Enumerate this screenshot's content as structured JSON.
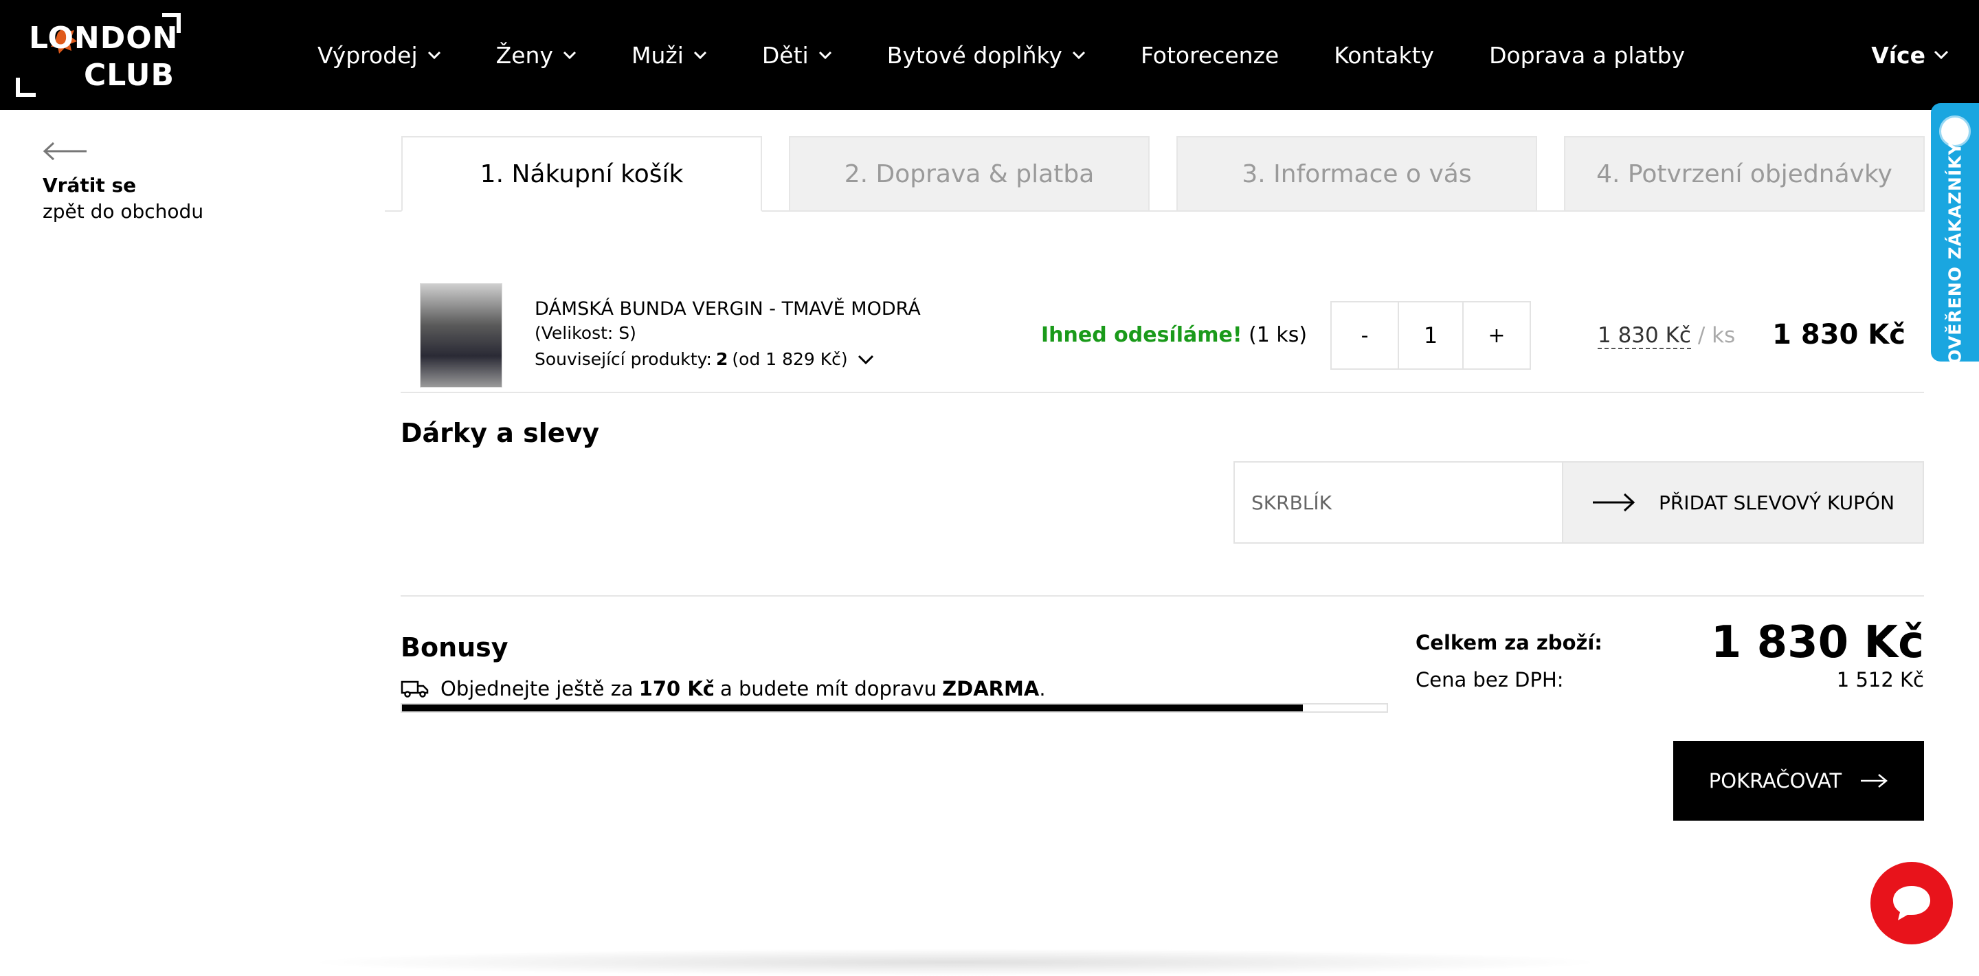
{
  "header": {
    "logo": {
      "line1": "LONDON",
      "line2": "CLUB"
    },
    "nav": [
      {
        "label": "Výprodej",
        "has_dropdown": true
      },
      {
        "label": "Ženy",
        "has_dropdown": true
      },
      {
        "label": "Muži",
        "has_dropdown": true
      },
      {
        "label": "Děti",
        "has_dropdown": true
      },
      {
        "label": "Bytové doplňky",
        "has_dropdown": true
      },
      {
        "label": "Fotorecenze",
        "has_dropdown": false
      },
      {
        "label": "Kontakty",
        "has_dropdown": false
      },
      {
        "label": "Doprava a platby",
        "has_dropdown": false
      }
    ],
    "more_label": "Více"
  },
  "back": {
    "title": "Vrátit se",
    "subtitle": "zpět do obchodu"
  },
  "steps": [
    {
      "label": "1. Nákupní košík",
      "active": true
    },
    {
      "label": "2. Doprava & platba",
      "active": false
    },
    {
      "label": "3. Informace o vás",
      "active": false
    },
    {
      "label": "4. Potvrzení objednávky",
      "active": false
    }
  ],
  "cart": {
    "item": {
      "name": "DÁMSKÁ BUNDA VERGIN - TMAVĚ MODRÁ",
      "size": "(Velikost: S)",
      "related_prefix": "Související produkty:",
      "related_count": "2",
      "related_from": "(od 1 829 Kč)",
      "stock_status": "Ihned odesíláme!",
      "stock_qty": "(1 ks)",
      "qty_minus": "-",
      "quantity": "1",
      "qty_plus": "+",
      "unit_price": "1 830 Kč",
      "unit_suffix": "/ ks",
      "line_total": "1 830 Kč"
    }
  },
  "gifts": {
    "title": "Dárky a slevy",
    "coupon_placeholder": "SKRBLÍK",
    "coupon_button": "PŘIDAT SLEVOVÝ KUPÓN"
  },
  "bonus": {
    "title": "Bonusy",
    "msg_before": "Objednejte ještě za",
    "msg_amount": "170 Kč",
    "msg_middle": "a budete mít dopravu",
    "msg_free": "ZDARMA",
    "msg_end": ".",
    "progress_fraction": 0.915
  },
  "totals": {
    "goods_label": "Celkem za zboží:",
    "goods_value": "1 830 Kč",
    "net_label": "Cena bez DPH:",
    "net_value": "1 512 Kč"
  },
  "continue_label": "POKRAČOVAT",
  "side_badge": {
    "label": "OVĚŘENO ZÁKAZNÍKY",
    "color": "#1aa6e0"
  },
  "icons": {
    "back": "arrow-left-icon",
    "dropdown": "chevron-down-icon",
    "truck": "truck-icon",
    "arrow": "arrow-right-icon",
    "chat": "chat-bubble-icon"
  },
  "colors": {
    "header_bg": "#000000",
    "stock_ok": "#1a9a1a",
    "chat": "#e8131b",
    "accent": "#e8131b"
  }
}
